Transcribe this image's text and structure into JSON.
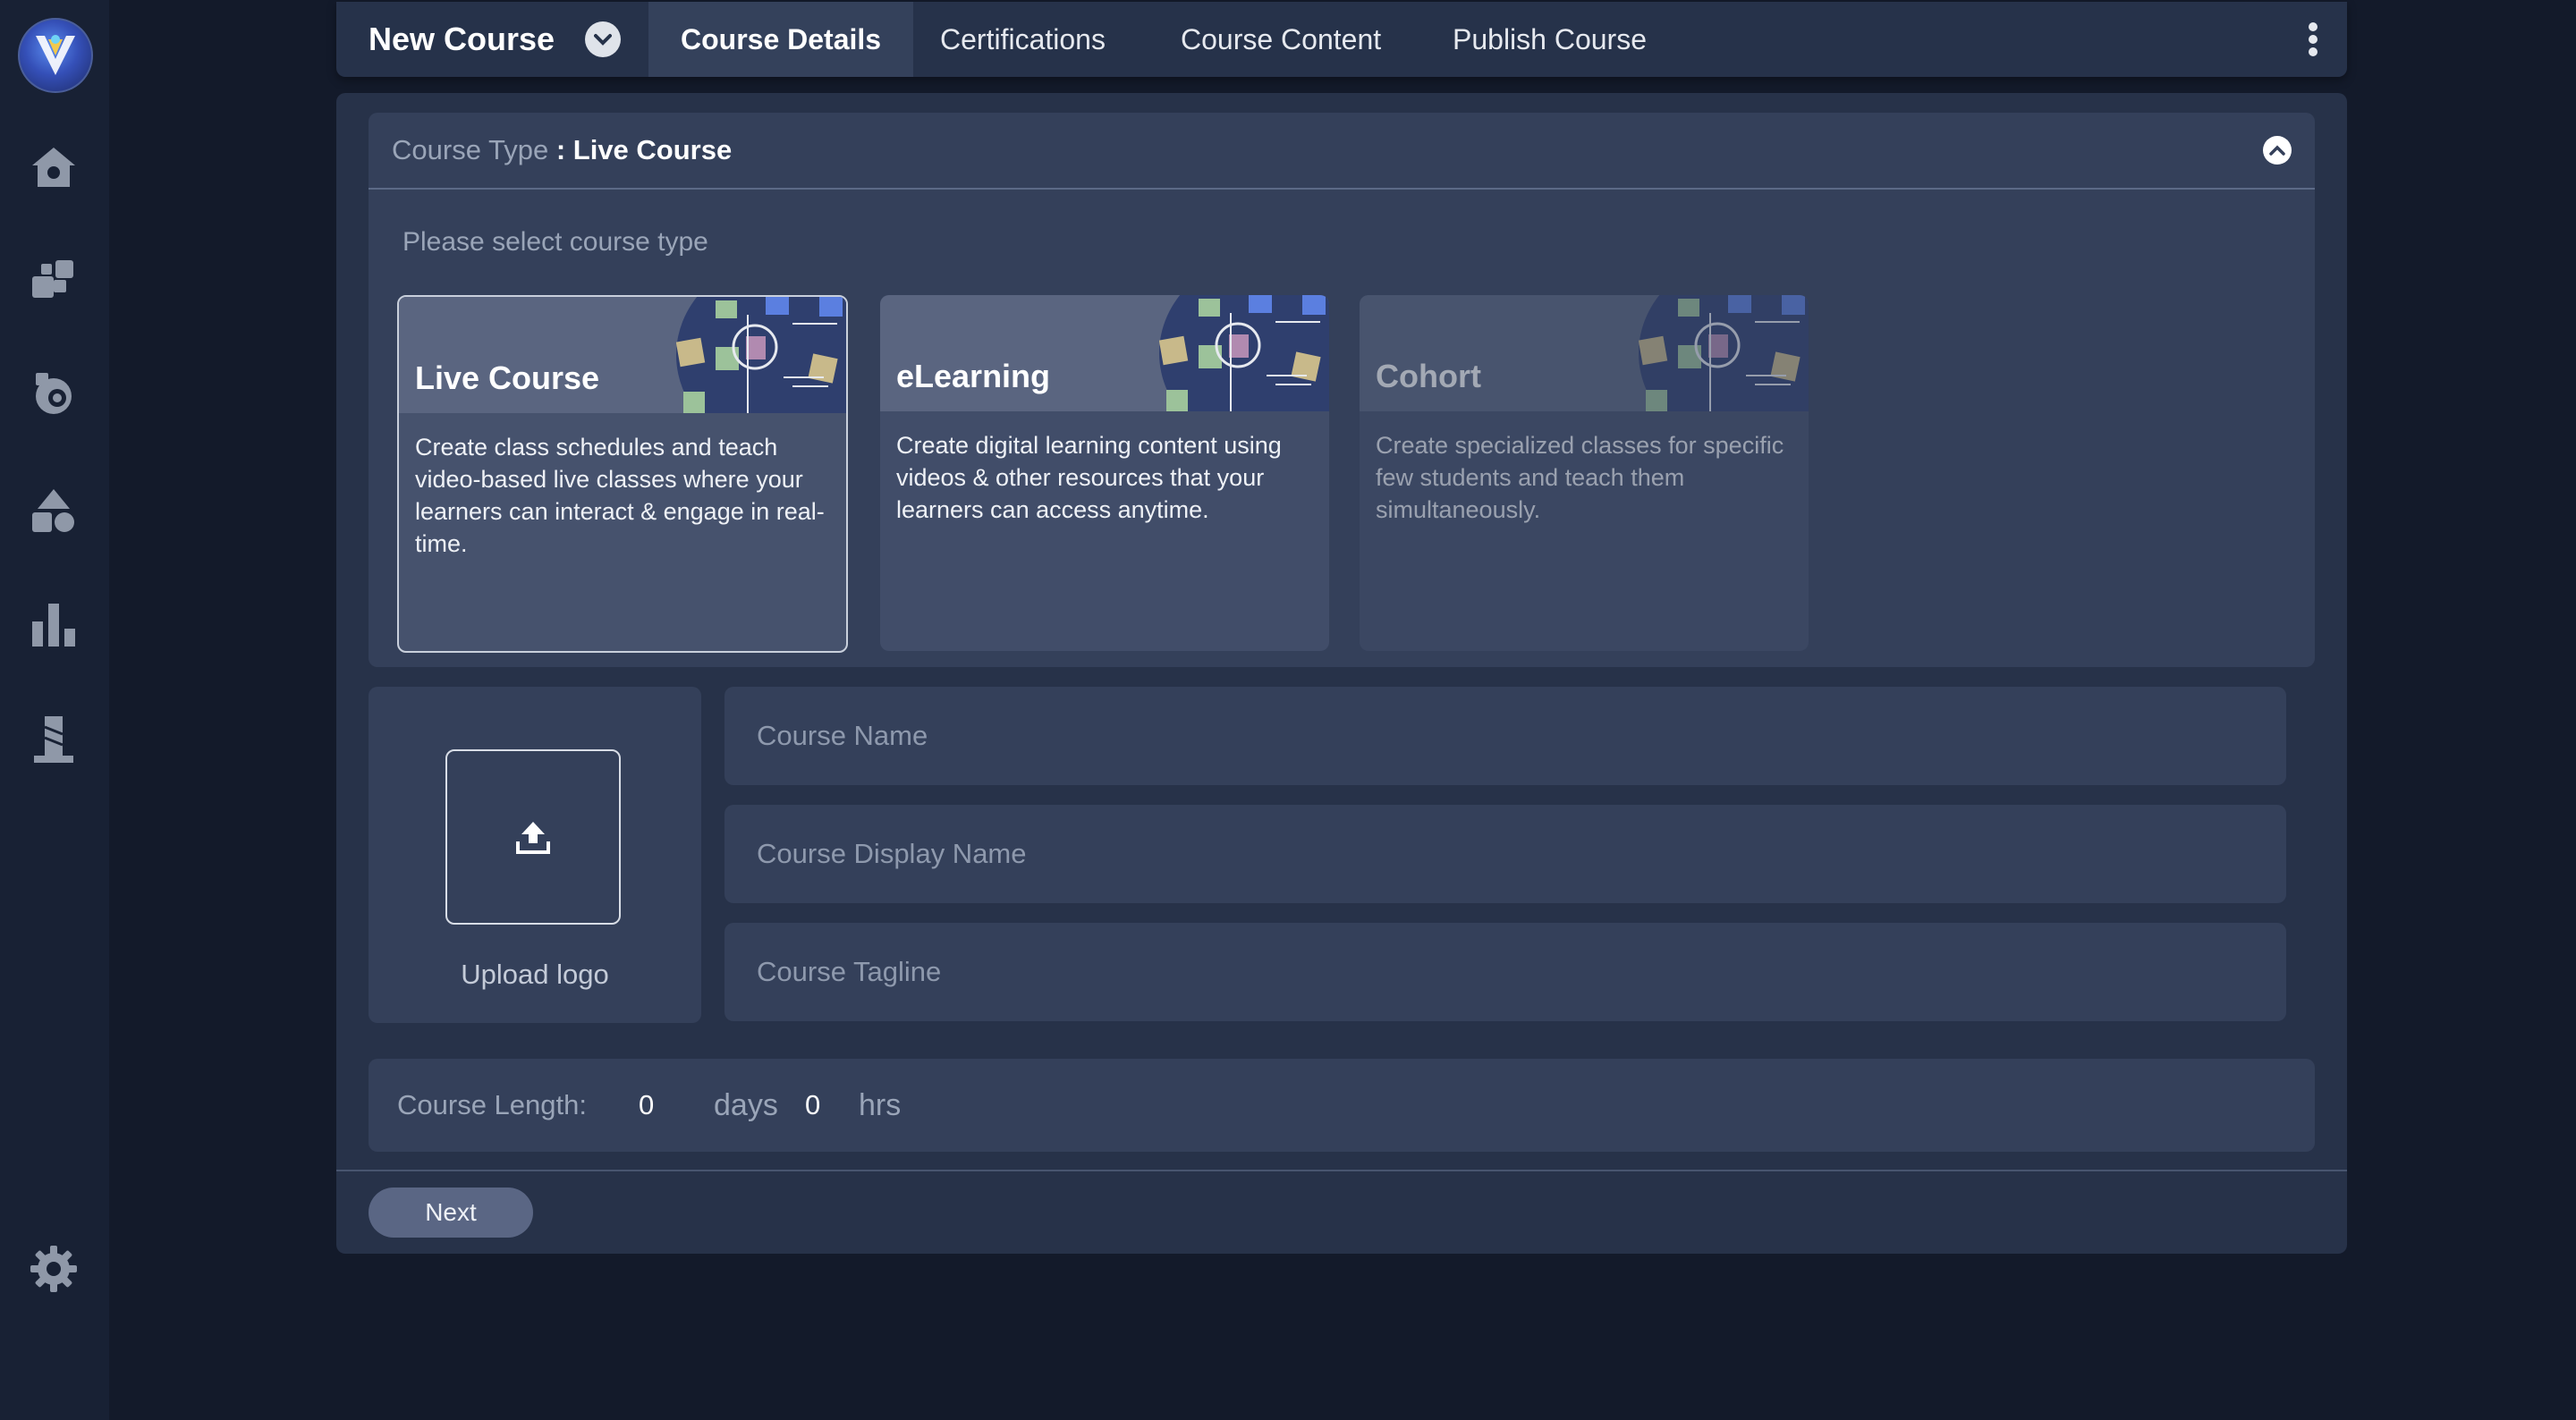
{
  "colors": {
    "background": "#131a2a",
    "sidebar": "#182134",
    "panel": "#273249",
    "card": "#34405a",
    "accent": "#4a7ff0"
  },
  "sidebar": {
    "items": [
      {
        "icon": "home-icon"
      },
      {
        "icon": "puzzle-icon"
      },
      {
        "icon": "learning-icon"
      },
      {
        "icon": "shapes-icon"
      },
      {
        "icon": "bar-chart-icon"
      },
      {
        "icon": "tower-icon"
      },
      {
        "icon": "gear-icon"
      }
    ]
  },
  "header": {
    "title": "New Course",
    "tabs": [
      {
        "label": "Course Details",
        "active": true
      },
      {
        "label": "Certifications",
        "active": false
      },
      {
        "label": "Course Content",
        "active": false
      },
      {
        "label": "Publish Course",
        "active": false
      }
    ]
  },
  "course_type": {
    "label": "Course Type",
    "value": ": Live Course",
    "prompt": "Please select course type",
    "options": [
      {
        "title": "Live Course",
        "description": "Create class schedules and teach video-based live classes where your learners can interact & engage in real-time.",
        "selected": true
      },
      {
        "title": "eLearning",
        "description": "Create digital learning content using videos & other resources that your learners can access anytime.",
        "selected": false
      },
      {
        "title": "Cohort",
        "description": "Create specialized classes for specific few students and teach them simultaneously.",
        "selected": false,
        "disabled": true
      }
    ]
  },
  "upload": {
    "label": "Upload logo"
  },
  "fields": {
    "course_name": {
      "placeholder": "Course Name",
      "value": ""
    },
    "display_name": {
      "placeholder": "Course Display Name",
      "value": ""
    },
    "tagline": {
      "placeholder": "Course Tagline",
      "value": ""
    }
  },
  "course_length": {
    "label": "Course Length:",
    "days_value": "0",
    "days_unit": "days",
    "hrs_value": "0",
    "hrs_unit": "hrs"
  },
  "footer": {
    "next_label": "Next"
  }
}
